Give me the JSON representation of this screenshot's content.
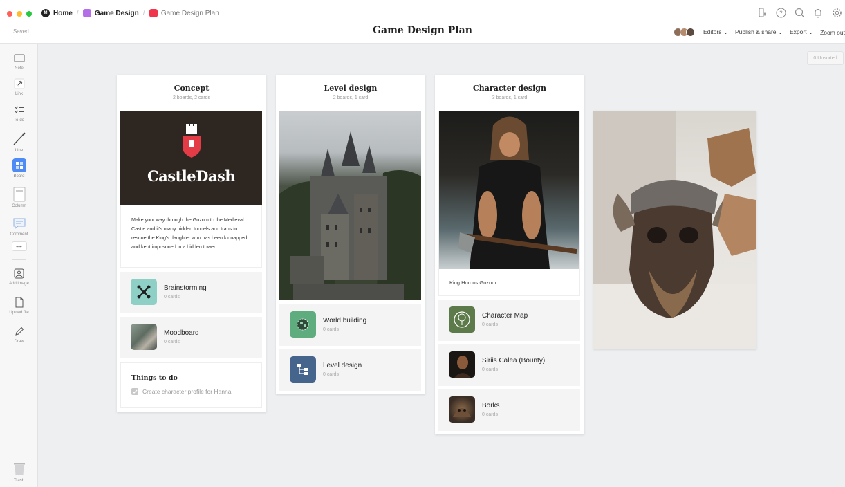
{
  "window": {
    "traffic_colors": [
      "#ff5f57",
      "#febc2e",
      "#28c840"
    ]
  },
  "breadcrumb": {
    "home_label": "Home",
    "home_icon_text": "M",
    "items": [
      {
        "label": "Game Design",
        "color": "#b36ee8"
      },
      {
        "label": "Game Design Plan",
        "color": "#f0354d"
      }
    ]
  },
  "header": {
    "saved": "Saved",
    "title": "Game Design Plan",
    "editors": "Editors",
    "publish": "Publish & share",
    "export": "Export",
    "zoom": "Zoom out",
    "icons": [
      "device-icon",
      "help-icon",
      "search-icon",
      "bell-icon",
      "settings-icon"
    ]
  },
  "toolbar": {
    "items": [
      {
        "label": "Note",
        "icon": "note-icon"
      },
      {
        "label": "Link",
        "icon": "link-icon"
      },
      {
        "label": "To-do",
        "icon": "todo-icon"
      },
      {
        "label": "Line",
        "icon": "line-icon"
      },
      {
        "label": "Board",
        "icon": "board-icon"
      },
      {
        "label": "Column",
        "icon": "column-icon"
      },
      {
        "label": "Comment",
        "icon": "comment-icon"
      },
      {
        "label": "Add image",
        "icon": "image-icon"
      },
      {
        "label": "Upload file",
        "icon": "file-icon"
      },
      {
        "label": "Draw",
        "icon": "pencil-icon"
      },
      {
        "label": "Trash",
        "icon": "trash-icon"
      }
    ],
    "more": "•••"
  },
  "unsorted": {
    "count": "0",
    "label": "Unsorted"
  },
  "columns": [
    {
      "title": "Concept",
      "subtitle": "2 boards, 2 cards",
      "logo_text": "CastleDash",
      "description": "Make your way through the Gozom to the Medieval Castle and it's many hidden tunnels and traps to rescue the King's daughter who has been kidnapped and kept imprisoned in a hidden tower.",
      "boards": [
        {
          "name": "Brainstorming",
          "count": "0 cards",
          "icon": "network-icon",
          "color": "#8ecfc6"
        },
        {
          "name": "Moodboard",
          "count": "0 cards",
          "icon": "moodboard-thumbnail",
          "color": "#5d6b61"
        }
      ],
      "todo": {
        "title": "Things to do",
        "items": [
          {
            "text": "Create character profile for Hanna",
            "done": true
          }
        ]
      }
    },
    {
      "title": "Level design",
      "subtitle": "2 boards, 1 card",
      "boards": [
        {
          "name": "World building",
          "count": "0 cards",
          "icon": "globe-icon",
          "color": "#5fad7f"
        },
        {
          "name": "Level design",
          "count": "0 cards",
          "icon": "hierarchy-icon",
          "color": "#46658d"
        }
      ]
    },
    {
      "title": "Character design",
      "subtitle": "3 boards, 1 card",
      "image_caption": "King Hordos Gozom",
      "boards": [
        {
          "name": "Character Map",
          "count": "0 cards",
          "icon": "tree-icon",
          "color": "#5d7a4a"
        },
        {
          "name": "Siriis Calea (Bounty)",
          "count": "0 cards",
          "icon": "portrait-thumbnail",
          "color": "#2d241e"
        },
        {
          "name": "Borks",
          "count": "0 cards",
          "icon": "creature-thumbnail",
          "color": "#3a2d25"
        }
      ]
    }
  ]
}
